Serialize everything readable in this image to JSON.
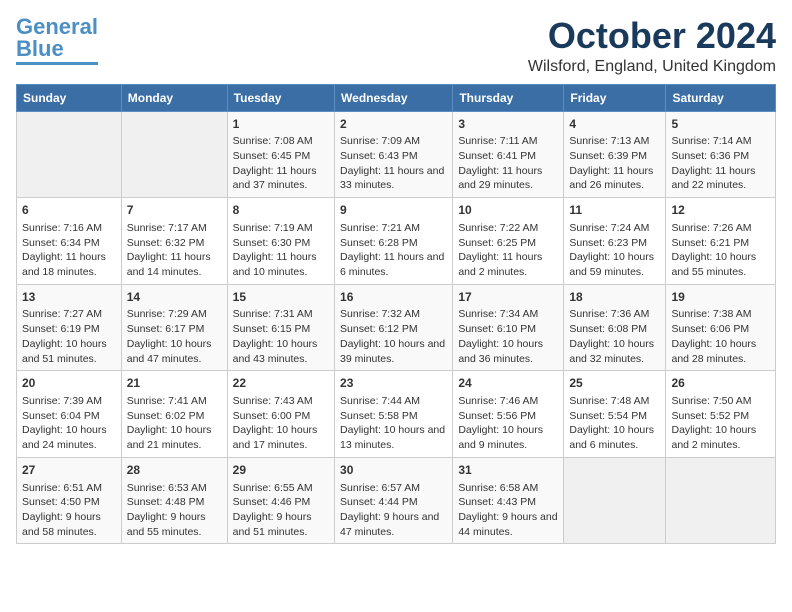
{
  "app": {
    "logo_line1": "General",
    "logo_line2": "Blue"
  },
  "header": {
    "month": "October 2024",
    "location": "Wilsford, England, United Kingdom"
  },
  "weekdays": [
    "Sunday",
    "Monday",
    "Tuesday",
    "Wednesday",
    "Thursday",
    "Friday",
    "Saturday"
  ],
  "weeks": [
    [
      {
        "day": "",
        "empty": true
      },
      {
        "day": "",
        "empty": true
      },
      {
        "day": "1",
        "sunrise": "7:08 AM",
        "sunset": "6:45 PM",
        "daylight": "11 hours and 37 minutes."
      },
      {
        "day": "2",
        "sunrise": "7:09 AM",
        "sunset": "6:43 PM",
        "daylight": "11 hours and 33 minutes."
      },
      {
        "day": "3",
        "sunrise": "7:11 AM",
        "sunset": "6:41 PM",
        "daylight": "11 hours and 29 minutes."
      },
      {
        "day": "4",
        "sunrise": "7:13 AM",
        "sunset": "6:39 PM",
        "daylight": "11 hours and 26 minutes."
      },
      {
        "day": "5",
        "sunrise": "7:14 AM",
        "sunset": "6:36 PM",
        "daylight": "11 hours and 22 minutes."
      }
    ],
    [
      {
        "day": "6",
        "sunrise": "7:16 AM",
        "sunset": "6:34 PM",
        "daylight": "11 hours and 18 minutes."
      },
      {
        "day": "7",
        "sunrise": "7:17 AM",
        "sunset": "6:32 PM",
        "daylight": "11 hours and 14 minutes."
      },
      {
        "day": "8",
        "sunrise": "7:19 AM",
        "sunset": "6:30 PM",
        "daylight": "11 hours and 10 minutes."
      },
      {
        "day": "9",
        "sunrise": "7:21 AM",
        "sunset": "6:28 PM",
        "daylight": "11 hours and 6 minutes."
      },
      {
        "day": "10",
        "sunrise": "7:22 AM",
        "sunset": "6:25 PM",
        "daylight": "11 hours and 2 minutes."
      },
      {
        "day": "11",
        "sunrise": "7:24 AM",
        "sunset": "6:23 PM",
        "daylight": "10 hours and 59 minutes."
      },
      {
        "day": "12",
        "sunrise": "7:26 AM",
        "sunset": "6:21 PM",
        "daylight": "10 hours and 55 minutes."
      }
    ],
    [
      {
        "day": "13",
        "sunrise": "7:27 AM",
        "sunset": "6:19 PM",
        "daylight": "10 hours and 51 minutes."
      },
      {
        "day": "14",
        "sunrise": "7:29 AM",
        "sunset": "6:17 PM",
        "daylight": "10 hours and 47 minutes."
      },
      {
        "day": "15",
        "sunrise": "7:31 AM",
        "sunset": "6:15 PM",
        "daylight": "10 hours and 43 minutes."
      },
      {
        "day": "16",
        "sunrise": "7:32 AM",
        "sunset": "6:12 PM",
        "daylight": "10 hours and 39 minutes."
      },
      {
        "day": "17",
        "sunrise": "7:34 AM",
        "sunset": "6:10 PM",
        "daylight": "10 hours and 36 minutes."
      },
      {
        "day": "18",
        "sunrise": "7:36 AM",
        "sunset": "6:08 PM",
        "daylight": "10 hours and 32 minutes."
      },
      {
        "day": "19",
        "sunrise": "7:38 AM",
        "sunset": "6:06 PM",
        "daylight": "10 hours and 28 minutes."
      }
    ],
    [
      {
        "day": "20",
        "sunrise": "7:39 AM",
        "sunset": "6:04 PM",
        "daylight": "10 hours and 24 minutes."
      },
      {
        "day": "21",
        "sunrise": "7:41 AM",
        "sunset": "6:02 PM",
        "daylight": "10 hours and 21 minutes."
      },
      {
        "day": "22",
        "sunrise": "7:43 AM",
        "sunset": "6:00 PM",
        "daylight": "10 hours and 17 minutes."
      },
      {
        "day": "23",
        "sunrise": "7:44 AM",
        "sunset": "5:58 PM",
        "daylight": "10 hours and 13 minutes."
      },
      {
        "day": "24",
        "sunrise": "7:46 AM",
        "sunset": "5:56 PM",
        "daylight": "10 hours and 9 minutes."
      },
      {
        "day": "25",
        "sunrise": "7:48 AM",
        "sunset": "5:54 PM",
        "daylight": "10 hours and 6 minutes."
      },
      {
        "day": "26",
        "sunrise": "7:50 AM",
        "sunset": "5:52 PM",
        "daylight": "10 hours and 2 minutes."
      }
    ],
    [
      {
        "day": "27",
        "sunrise": "6:51 AM",
        "sunset": "4:50 PM",
        "daylight": "9 hours and 58 minutes."
      },
      {
        "day": "28",
        "sunrise": "6:53 AM",
        "sunset": "4:48 PM",
        "daylight": "9 hours and 55 minutes."
      },
      {
        "day": "29",
        "sunrise": "6:55 AM",
        "sunset": "4:46 PM",
        "daylight": "9 hours and 51 minutes."
      },
      {
        "day": "30",
        "sunrise": "6:57 AM",
        "sunset": "4:44 PM",
        "daylight": "9 hours and 47 minutes."
      },
      {
        "day": "31",
        "sunrise": "6:58 AM",
        "sunset": "4:43 PM",
        "daylight": "9 hours and 44 minutes."
      },
      {
        "day": "",
        "empty": true
      },
      {
        "day": "",
        "empty": true
      }
    ]
  ]
}
